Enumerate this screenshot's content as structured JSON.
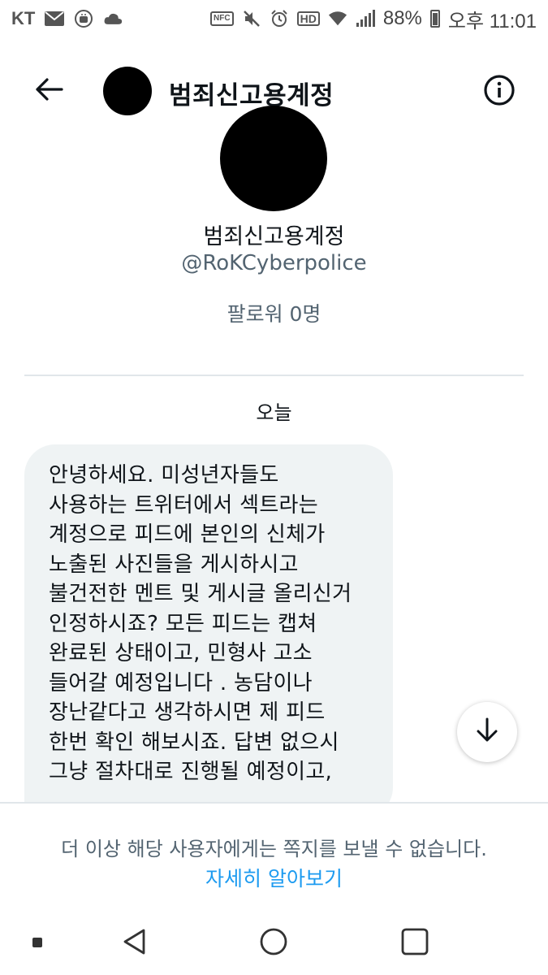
{
  "status_bar": {
    "carrier": "KT",
    "icons": [
      "mail-icon",
      "android-icon",
      "cloud-icon",
      "nfc-icon",
      "mute-icon",
      "alarm-icon",
      "hd-icon",
      "wifi-icon",
      "signal-icon",
      "battery-icon"
    ],
    "nfc_label": "NFC",
    "hd_label": "HD",
    "battery": "88%",
    "time": "오후 11:01"
  },
  "header": {
    "title": "범죄신고용계정",
    "back_icon": "arrow-left-icon",
    "info_icon": "info-circle-icon"
  },
  "profile": {
    "name": "범죄신고용계정",
    "handle": "@RoKCyberpolice",
    "followers": "팔로워 0명"
  },
  "conversation": {
    "date_label": "오늘",
    "message_lines": [
      "안녕하세요. 미성년자들도",
      "사용하는 트위터에서 섹트라는",
      "계정으로 피드에 본인의 신체가",
      "노출된 사진들을 게시하시고",
      "불건전한 멘트 및 게시글 올리신거",
      "인정하시죠? 모든 피드는 캡쳐",
      "완료된 상태이고, 민형사 고소",
      "들어갈 예정입니다 . 농담이나",
      "장난같다고 생각하시면 제 피드",
      "한번 확인 해보시죠. 답변 없으시",
      "그냥 절차대로 진행될 예정이고,"
    ]
  },
  "footer": {
    "notice": "더 이상 해당 사용자에게는 쪽지를 보낼 수 없습니다.",
    "link": "자세히 알아보기"
  },
  "colors": {
    "link": "#1d9bf0",
    "secondary_text": "#536471",
    "bubble": "#eff3f4"
  }
}
